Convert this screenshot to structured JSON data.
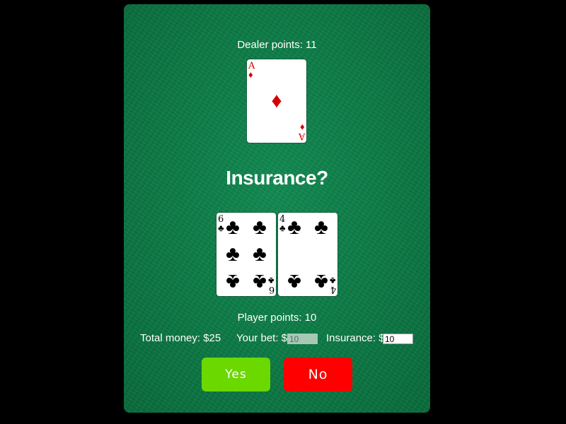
{
  "dealer": {
    "points_label": "Dealer points: 11",
    "card": {
      "rank": "A",
      "suit": "♦",
      "suit_name": "diamonds",
      "color": "#d40000"
    }
  },
  "prompt": "Insurance?",
  "player": {
    "cards": [
      {
        "rank": "6",
        "suit": "♣",
        "suit_name": "clubs",
        "color": "#000000"
      },
      {
        "rank": "4",
        "suit": "♣",
        "suit_name": "clubs",
        "color": "#000000"
      }
    ],
    "points_label": "Player points: 10"
  },
  "stats": {
    "total_money_label": "Total money: $25",
    "bet_label": "Your bet: $",
    "bet_value": "10",
    "insurance_label": "Insurance: $",
    "insurance_value": "10"
  },
  "buttons": {
    "yes": "Yes",
    "no": "No"
  },
  "colors": {
    "table": "#0c7a45",
    "yes_button": "#6bd800",
    "no_button": "#ff0000"
  }
}
